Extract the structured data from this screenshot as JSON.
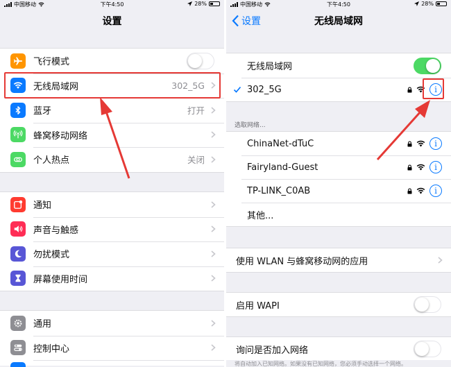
{
  "left": {
    "status": {
      "carrier": "中国移动",
      "time": "下午4:50",
      "battery": "28%"
    },
    "nav_title": "设置",
    "groups": [
      [
        {
          "label": "飞行模式",
          "icon": "airplane-icon",
          "icon_color": "#ff9500",
          "control": "toggle",
          "on": false
        },
        {
          "label": "无线局域网",
          "icon": "wifi-icon",
          "icon_color": "#0a7aff",
          "value": "302_5G",
          "control": "chevron"
        },
        {
          "label": "蓝牙",
          "icon": "bluetooth-icon",
          "icon_color": "#0a7aff",
          "value": "打开",
          "control": "chevron"
        },
        {
          "label": "蜂窝移动网络",
          "icon": "cellular-icon",
          "icon_color": "#4cd964",
          "control": "chevron"
        },
        {
          "label": "个人热点",
          "icon": "hotspot-icon",
          "icon_color": "#4cd964",
          "value": "关闭",
          "control": "chevron"
        }
      ],
      [
        {
          "label": "通知",
          "icon": "notifications-icon",
          "icon_color": "#ff3b30",
          "control": "chevron"
        },
        {
          "label": "声音与触感",
          "icon": "sound-icon",
          "icon_color": "#ff2d55",
          "control": "chevron"
        },
        {
          "label": "勿扰模式",
          "icon": "moon-icon",
          "icon_color": "#5856d6",
          "control": "chevron"
        },
        {
          "label": "屏幕使用时间",
          "icon": "hourglass-icon",
          "icon_color": "#5856d6",
          "control": "chevron"
        }
      ],
      [
        {
          "label": "通用",
          "icon": "gear-icon",
          "icon_color": "#8e8e93",
          "control": "chevron"
        },
        {
          "label": "控制中心",
          "icon": "control-center-icon",
          "icon_color": "#8e8e93",
          "control": "chevron"
        }
      ]
    ]
  },
  "right": {
    "status": {
      "carrier": "中国移动",
      "time": "下午4:50",
      "battery": "28%"
    },
    "nav_title": "无线局域网",
    "back_label": "设置",
    "wifi_toggle_label": "无线局域网",
    "wifi_on": true,
    "connected_network": "302_5G",
    "choose_network_caption": "选取网络...",
    "networks": [
      "ChinaNet-dTuC",
      "Fairyland-Guest",
      "TP-LINK_C0AB"
    ],
    "other_label": "其他...",
    "apps_using_label": "使用 WLAN 与蜂窝移动网的应用",
    "wapi_label": "启用 WAPI",
    "ask_join_label": "询问是否加入网络",
    "footer_partial": "将自动加入已知网络。如果没有已知网络，您必须手动选择一个网络。"
  },
  "colors": {
    "accent": "#0a7aff",
    "toggle_on": "#4cd964",
    "annotation": "#e53935"
  }
}
